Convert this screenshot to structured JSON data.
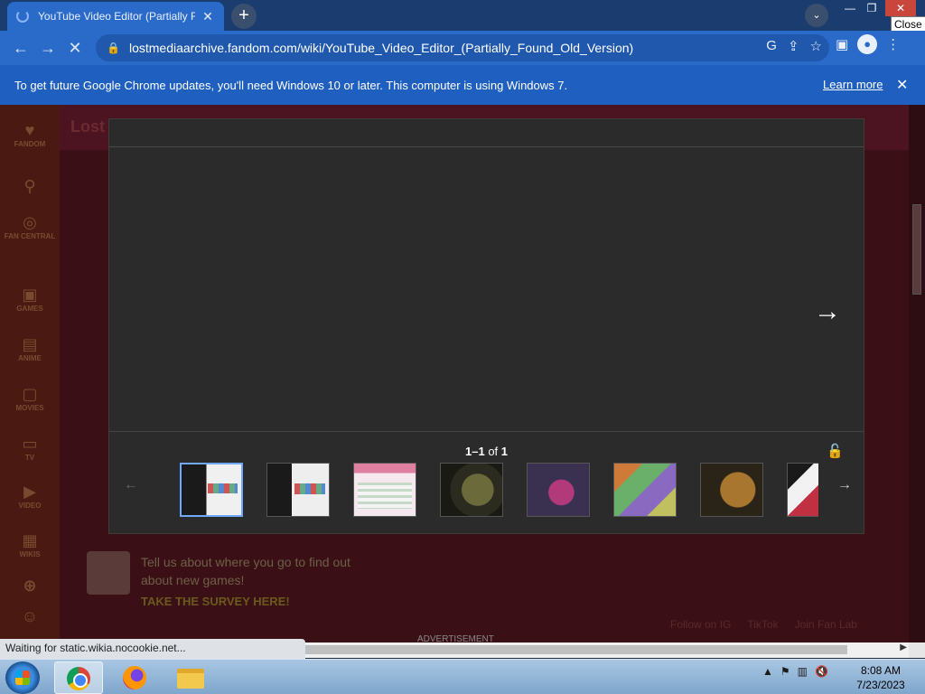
{
  "browser": {
    "tab_title": "YouTube Video Editor (Partially F",
    "tab_close": "✕",
    "new_tab": "+",
    "tab_search": "⌄",
    "url": "lostmediaarchive.fandom.com/wiki/YouTube_Video_Editor_(Partially_Found_Old_Version)",
    "tooltip": "Close",
    "window_controls": {
      "minimize": "—",
      "maximize": "❐",
      "close": "✕"
    },
    "nav": {
      "back": "←",
      "forward": "→",
      "stop": "✕"
    }
  },
  "infobar": {
    "message": "To get future Google Chrome updates, you'll need Windows 10 or later. This computer is using Windows 7.",
    "learn_more": "Learn more",
    "close": "✕"
  },
  "page": {
    "rail_items": [
      "FANDOM",
      "",
      "FAN CENTRAL",
      "GAMES",
      "ANIME",
      "MOVIES",
      "TV",
      "VIDEO",
      "WIKIS",
      "",
      ""
    ],
    "wiki_name": "Lost",
    "survey_text": "Tell us about where you go to find out about new games!",
    "survey_cta": "TAKE THE SURVEY HERE!",
    "ad_label": "ADVERTISEMENT",
    "follow_links": [
      "Follow on IG",
      "TikTok",
      "Join Fan Lab"
    ]
  },
  "lightbox": {
    "counter_range": "1–1",
    "counter_of": "of",
    "counter_total": "1",
    "next_arrow": "→",
    "strip_prev": "←",
    "strip_next": "→",
    "thumbnails_count": 8,
    "selected_thumbnail": 1
  },
  "status": {
    "text": "Waiting for static.wikia.nocookie.net..."
  },
  "taskbar": {
    "time": "8:08 AM",
    "date": "7/23/2023",
    "tray_arrow": "▲"
  },
  "colors": {
    "chrome_blue": "#2a6ac8",
    "infobar_blue": "#1f5fbf",
    "lightbox_bg": "#2b2b2b",
    "selected_border": "#6ea8ff",
    "close_red": "#c9463d"
  }
}
